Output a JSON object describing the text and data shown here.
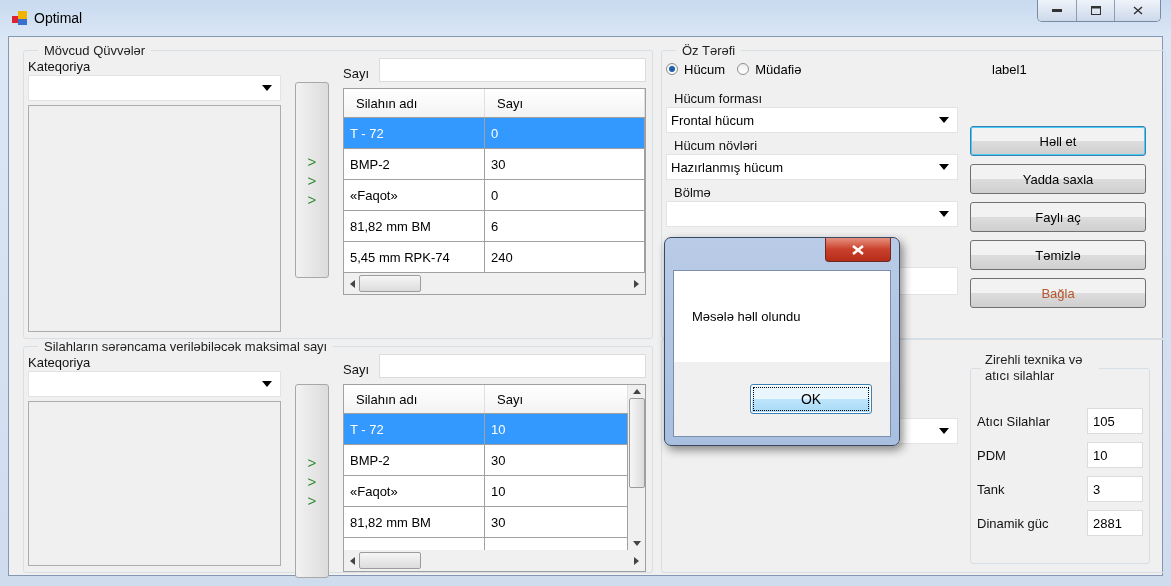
{
  "window": {
    "title": "Optimal"
  },
  "available_forces": {
    "title": "Mövcud Qüvvələr",
    "category_label": "Kateqoriya",
    "count_label": "Sayı",
    "transfer_arrows": [
      ">",
      ">",
      ">"
    ],
    "table": {
      "columns": [
        "Silahın adı",
        "Sayı"
      ],
      "rows": [
        {
          "cells": [
            "T - 72",
            "0"
          ],
          "selected": true
        },
        {
          "cells": [
            "BMP-2",
            "30"
          ],
          "selected": false
        },
        {
          "cells": [
            "«Faqot»",
            "0"
          ],
          "selected": false
        },
        {
          "cells": [
            "81,82 mm BM",
            "6"
          ],
          "selected": false
        },
        {
          "cells": [
            "5,45 mm RPK-74",
            "240"
          ],
          "selected": false
        }
      ]
    }
  },
  "max_allocation": {
    "title": "Silahların sərəncama veriləbiləcək maksimal sayı",
    "category_label": "Kateqoriya",
    "count_label": "Sayı",
    "transfer_arrows": [
      ">",
      ">",
      ">"
    ],
    "table": {
      "columns": [
        "Silahın adı",
        "Sayı"
      ],
      "rows": [
        {
          "cells": [
            "T - 72",
            "10"
          ],
          "selected": true
        },
        {
          "cells": [
            "BMP-2",
            "30"
          ],
          "selected": false
        },
        {
          "cells": [
            "«Faqot»",
            "10"
          ],
          "selected": false
        },
        {
          "cells": [
            "81,82 mm BM",
            "30"
          ],
          "selected": false
        }
      ]
    }
  },
  "own_side": {
    "title": "Öz Tərəfi",
    "modes": [
      {
        "label": "Hücum",
        "selected": true
      },
      {
        "label": "Müdafiə",
        "selected": false
      }
    ],
    "status_label": "label1",
    "attack_form": {
      "label": "Hücum forması",
      "value": "Frontal hücum"
    },
    "attack_type": {
      "label": "Hücum növləri",
      "value": "Hazırlanmış hücum"
    },
    "division": {
      "label": "Bölmə"
    },
    "buttons": [
      {
        "label": "Həll et",
        "kind": "default"
      },
      {
        "label": "Yadda saxla",
        "kind": "normal"
      },
      {
        "label": "Faylı aç",
        "kind": "normal"
      },
      {
        "label": "Təmizlə",
        "kind": "normal"
      },
      {
        "label": "Bağla",
        "kind": "danger"
      }
    ]
  },
  "armor_group": {
    "title": "Zirehli texnika və atıcı silahlar",
    "fields": [
      {
        "label": "Atıcı Silahlar",
        "value": "105"
      },
      {
        "label": "PDM",
        "value": "10"
      },
      {
        "label": "Tank",
        "value": "3"
      },
      {
        "label": "Dinamik güc",
        "value": "2881"
      }
    ]
  },
  "dialog": {
    "message": "Məsələ həll olundu",
    "button": "OK"
  }
}
